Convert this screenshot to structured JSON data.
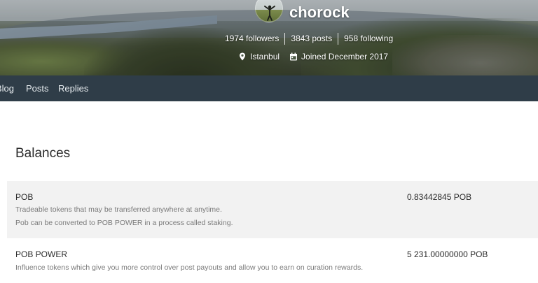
{
  "profile": {
    "username": "chorock",
    "stats": {
      "followers": "1974 followers",
      "posts": "3843 posts",
      "following": "958 following"
    },
    "location": "Istanbul",
    "joined": "Joined December 2017"
  },
  "nav": {
    "items": [
      "Blog",
      "Posts",
      "Replies"
    ]
  },
  "balances": {
    "title": "Balances",
    "rows": [
      {
        "name": "POB",
        "descriptions": [
          "Tradeable tokens that may be transferred anywhere at anytime.",
          "Pob can be converted to POB POWER in a process called staking."
        ],
        "amount": "0.83442845 POB"
      },
      {
        "name": "POB POWER",
        "descriptions": [
          "Influence tokens which give you more control over post payouts and allow you to earn on curation rewards."
        ],
        "amount": "5 231.00000000 POB"
      }
    ]
  },
  "colors": {
    "navbar": "#2f3d48",
    "shaded_row": "#f2f2f2",
    "muted_text": "#7a7a7a"
  },
  "icons": {
    "location": "location-pin-icon",
    "calendar": "calendar-icon"
  }
}
